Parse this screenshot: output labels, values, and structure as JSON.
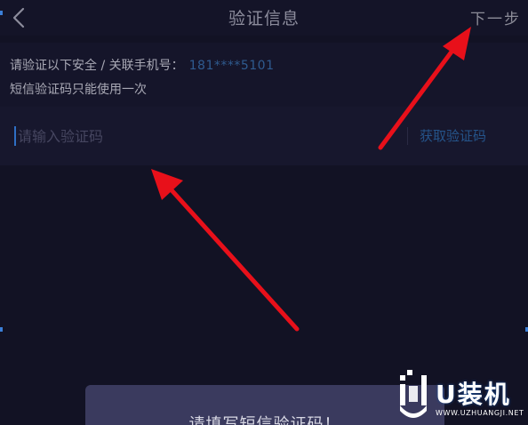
{
  "header": {
    "title": "验证信息",
    "next_label": "下一步",
    "back_icon": "chevron-left-icon"
  },
  "info": {
    "line1_prefix": "请验证以下安全 / 关联手机号：",
    "phone_masked": "181****5101",
    "line2": "短信验证码只能使用一次"
  },
  "form": {
    "code_placeholder": "请输入验证码",
    "code_value": "",
    "get_code_label": "获取验证码"
  },
  "toast": {
    "message": "请填写短信验证码！"
  },
  "watermark": {
    "brand": "U装机",
    "url": "WWW.UZHUANGJI.NET"
  },
  "colors": {
    "background": "#121224",
    "accent_blue": "#25548a",
    "annotation_red": "#e8101a",
    "toast_bg": "#3a3a5e"
  }
}
